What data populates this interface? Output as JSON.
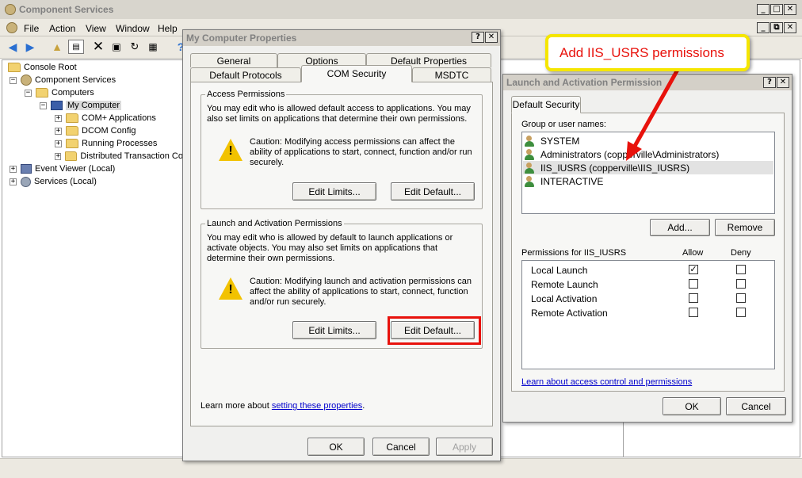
{
  "main_window": {
    "title": "Component Services",
    "menu": [
      "File",
      "Action",
      "View",
      "Window",
      "Help"
    ],
    "controls": {
      "minimize": "_",
      "maximize": "□",
      "close": "✕",
      "restore": "⧉"
    }
  },
  "tree": {
    "items": [
      {
        "label": "Console Root",
        "expander": "",
        "icon": "console-root-icon"
      },
      {
        "label": "Component Services",
        "expander": "−",
        "icon": "component-services-icon"
      },
      {
        "label": "Computers",
        "expander": "−",
        "icon": "folder-icon"
      },
      {
        "label": "My Computer",
        "expander": "−",
        "icon": "computer-icon"
      },
      {
        "label": "COM+ Applications",
        "expander": "+",
        "icon": "folder-icon"
      },
      {
        "label": "DCOM Config",
        "expander": "+",
        "icon": "folder-icon"
      },
      {
        "label": "Running Processes",
        "expander": "+",
        "icon": "folder-icon"
      },
      {
        "label": "Distributed Transaction Co",
        "expander": "+",
        "icon": "folder-icon"
      },
      {
        "label": "Event Viewer (Local)",
        "expander": "+",
        "icon": "event-viewer-icon"
      },
      {
        "label": "Services (Local)",
        "expander": "+",
        "icon": "services-icon"
      }
    ]
  },
  "properties_dialog": {
    "title": "My Computer Properties",
    "help": "?",
    "close": "✕",
    "tabs_row1": [
      "General",
      "Options",
      "Default Properties"
    ],
    "tabs_row2": [
      "Default Protocols",
      "COM Security",
      "MSDTC"
    ],
    "active_tab": "COM Security",
    "access": {
      "title": "Access Permissions",
      "description": "You may edit who is allowed default access to applications. You may also set limits on applications that determine their own permissions.",
      "caution": "Caution: Modifying access permissions can affect the ability of applications to start, connect, function and/or run securely.",
      "edit_limits": "Edit Limits...",
      "edit_default": "Edit Default..."
    },
    "launch": {
      "title": "Launch and Activation Permissions",
      "description": "You may edit who is allowed by default to launch applications or activate objects. You may also set limits on applications that determine their own permissions.",
      "caution": "Caution: Modifying launch and activation permissions can affect the ability of applications to start, connect, function and/or run securely.",
      "edit_limits": "Edit Limits...",
      "edit_default": "Edit Default..."
    },
    "learn_more_prefix": "Learn more about ",
    "learn_more_link": "setting these properties",
    "learn_more_suffix": ".",
    "ok": "OK",
    "cancel": "Cancel",
    "apply": "Apply"
  },
  "launch_dialog": {
    "title": "Launch and Activation Permission",
    "help": "?",
    "close": "✕",
    "tab": "Default Security",
    "group_label": "Group or user names:",
    "users": [
      "SYSTEM",
      "Administrators (copperville\\Administrators)",
      "IIS_IUSRS (copperville\\IIS_IUSRS)",
      "INTERACTIVE"
    ],
    "selected_user": "IIS_IUSRS (copperville\\IIS_IUSRS)",
    "add": "Add...",
    "remove": "Remove",
    "permissions_label": "Permissions for IIS_IUSRS",
    "allow_header": "Allow",
    "deny_header": "Deny",
    "permissions": [
      {
        "name": "Local Launch",
        "allow": true,
        "deny": false
      },
      {
        "name": "Remote Launch",
        "allow": false,
        "deny": false
      },
      {
        "name": "Local Activation",
        "allow": false,
        "deny": false
      },
      {
        "name": "Remote Activation",
        "allow": false,
        "deny": false
      }
    ],
    "check_glyph": "✓",
    "learn_link": "Learn about access control and permissions",
    "ok": "OK",
    "cancel": "Cancel"
  },
  "callout": {
    "text": "Add IIS_USRS permissions",
    "border_color": "#f5e600",
    "arrow_color": "#e8120c"
  },
  "highlight_color": "#e8120c"
}
